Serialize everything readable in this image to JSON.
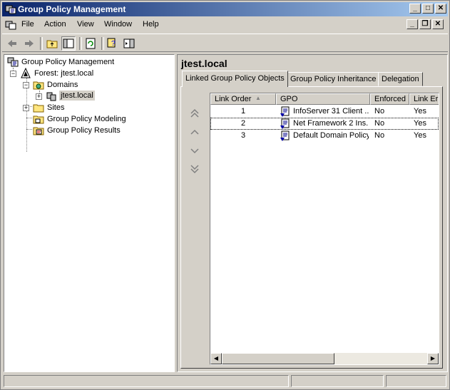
{
  "window": {
    "title": "Group Policy Management",
    "caption_buttons": [
      "minimize-icon",
      "maximize-icon",
      "close-icon"
    ]
  },
  "menubar": {
    "items": [
      {
        "label": "File"
      },
      {
        "label": "Action"
      },
      {
        "label": "View"
      },
      {
        "label": "Window"
      },
      {
        "label": "Help"
      }
    ]
  },
  "toolbar": {
    "icons": [
      "back-arrow-icon",
      "forward-arrow-icon",
      "up-folder-icon",
      "show-hide-tree-icon",
      "refresh-icon",
      "help-icon",
      "console-icon"
    ]
  },
  "tree": {
    "root": "Group Policy Management",
    "forest": "Forest: jtest.local",
    "domains": "Domains",
    "domain": "jtest.local",
    "sites": "Sites",
    "modeling": "Group Policy Modeling",
    "results": "Group Policy Results"
  },
  "detail": {
    "title": "jtest.local",
    "tabs": [
      {
        "label": "Linked Group Policy Objects",
        "active": true
      },
      {
        "label": "Group Policy Inheritance",
        "active": false
      },
      {
        "label": "Delegation",
        "active": false
      }
    ],
    "columns": [
      "Link Order",
      "GPO",
      "Enforced",
      "Link Er"
    ],
    "sort_indicator": "▲",
    "rows": [
      {
        "order": "1",
        "gpo": "InfoServer 31 Client ...",
        "enforced": "No",
        "link_enabled": "Yes"
      },
      {
        "order": "2",
        "gpo": "Net Framework 2 Ins...",
        "enforced": "No",
        "link_enabled": "Yes"
      },
      {
        "order": "3",
        "gpo": "Default Domain Policy",
        "enforced": "No",
        "link_enabled": "Yes"
      }
    ],
    "move_buttons": [
      "move-top-icon",
      "move-up-icon",
      "move-down-icon",
      "move-bottom-icon"
    ]
  },
  "colors": {
    "titlebar_start": "#0a246a",
    "titlebar_end": "#a6caf0",
    "face": "#d4d0c8",
    "selection": "#d4d0c8"
  }
}
